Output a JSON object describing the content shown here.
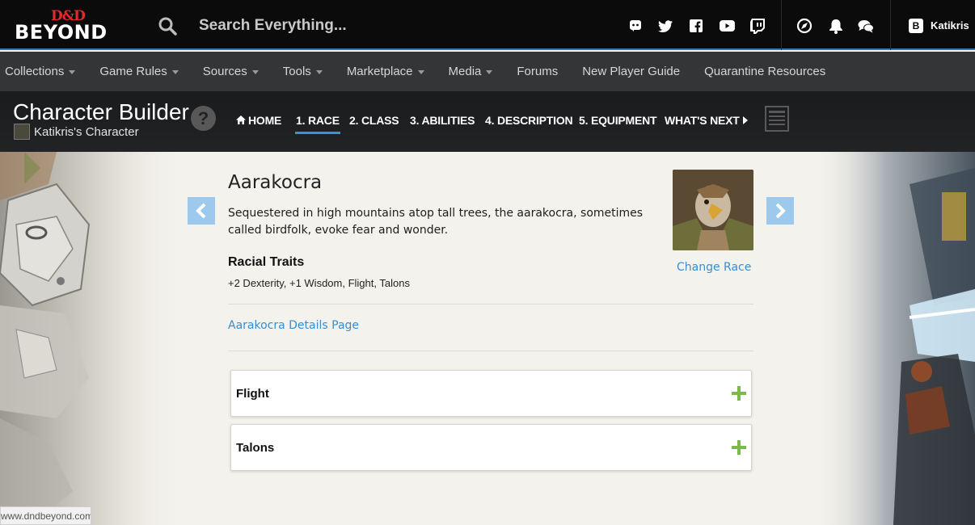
{
  "brand": {
    "dd": "D&D",
    "beyond": "BEYOND"
  },
  "search": {
    "placeholder": "Search Everything..."
  },
  "user": {
    "badge": "B",
    "name": "Katikris"
  },
  "nav": {
    "items": [
      {
        "label": "Collections",
        "dropdown": true
      },
      {
        "label": "Game Rules",
        "dropdown": true
      },
      {
        "label": "Sources",
        "dropdown": true
      },
      {
        "label": "Tools",
        "dropdown": true
      },
      {
        "label": "Marketplace",
        "dropdown": true
      },
      {
        "label": "Media",
        "dropdown": true
      },
      {
        "label": "Forums",
        "dropdown": false
      },
      {
        "label": "New Player Guide",
        "dropdown": false
      },
      {
        "label": "Quarantine Resources",
        "dropdown": false
      }
    ]
  },
  "builder": {
    "title": "Character Builder",
    "character_name": "Katikris's Character",
    "help": "?",
    "steps": [
      {
        "label": "HOME",
        "active": false
      },
      {
        "label": "1. RACE",
        "active": true
      },
      {
        "label": "2. CLASS",
        "active": false
      },
      {
        "label": "3. ABILITIES",
        "active": false
      },
      {
        "label": "4. DESCRIPTION",
        "active": false
      },
      {
        "label": "5. EQUIPMENT",
        "active": false
      },
      {
        "label": "WHAT'S NEXT",
        "active": false
      }
    ]
  },
  "race": {
    "name": "Aarakocra",
    "description": "Sequestered in high mountains atop tall trees, the aarakocra, sometimes called birdfolk, evoke fear and wonder.",
    "traits_heading": "Racial Traits",
    "traits_summary": "+2 Dexterity, +1 Wisdom, Flight, Talons",
    "change_label": "Change Race",
    "details_link": "Aarakocra Details Page",
    "trait_cards": [
      {
        "label": "Flight"
      },
      {
        "label": "Talons"
      }
    ]
  },
  "status_url": "www.dndbeyond.com",
  "colors": {
    "accent": "#2b98d9",
    "link": "#3a8cd0",
    "plus": "#7cb84a",
    "arrow": "#9dcaec"
  }
}
